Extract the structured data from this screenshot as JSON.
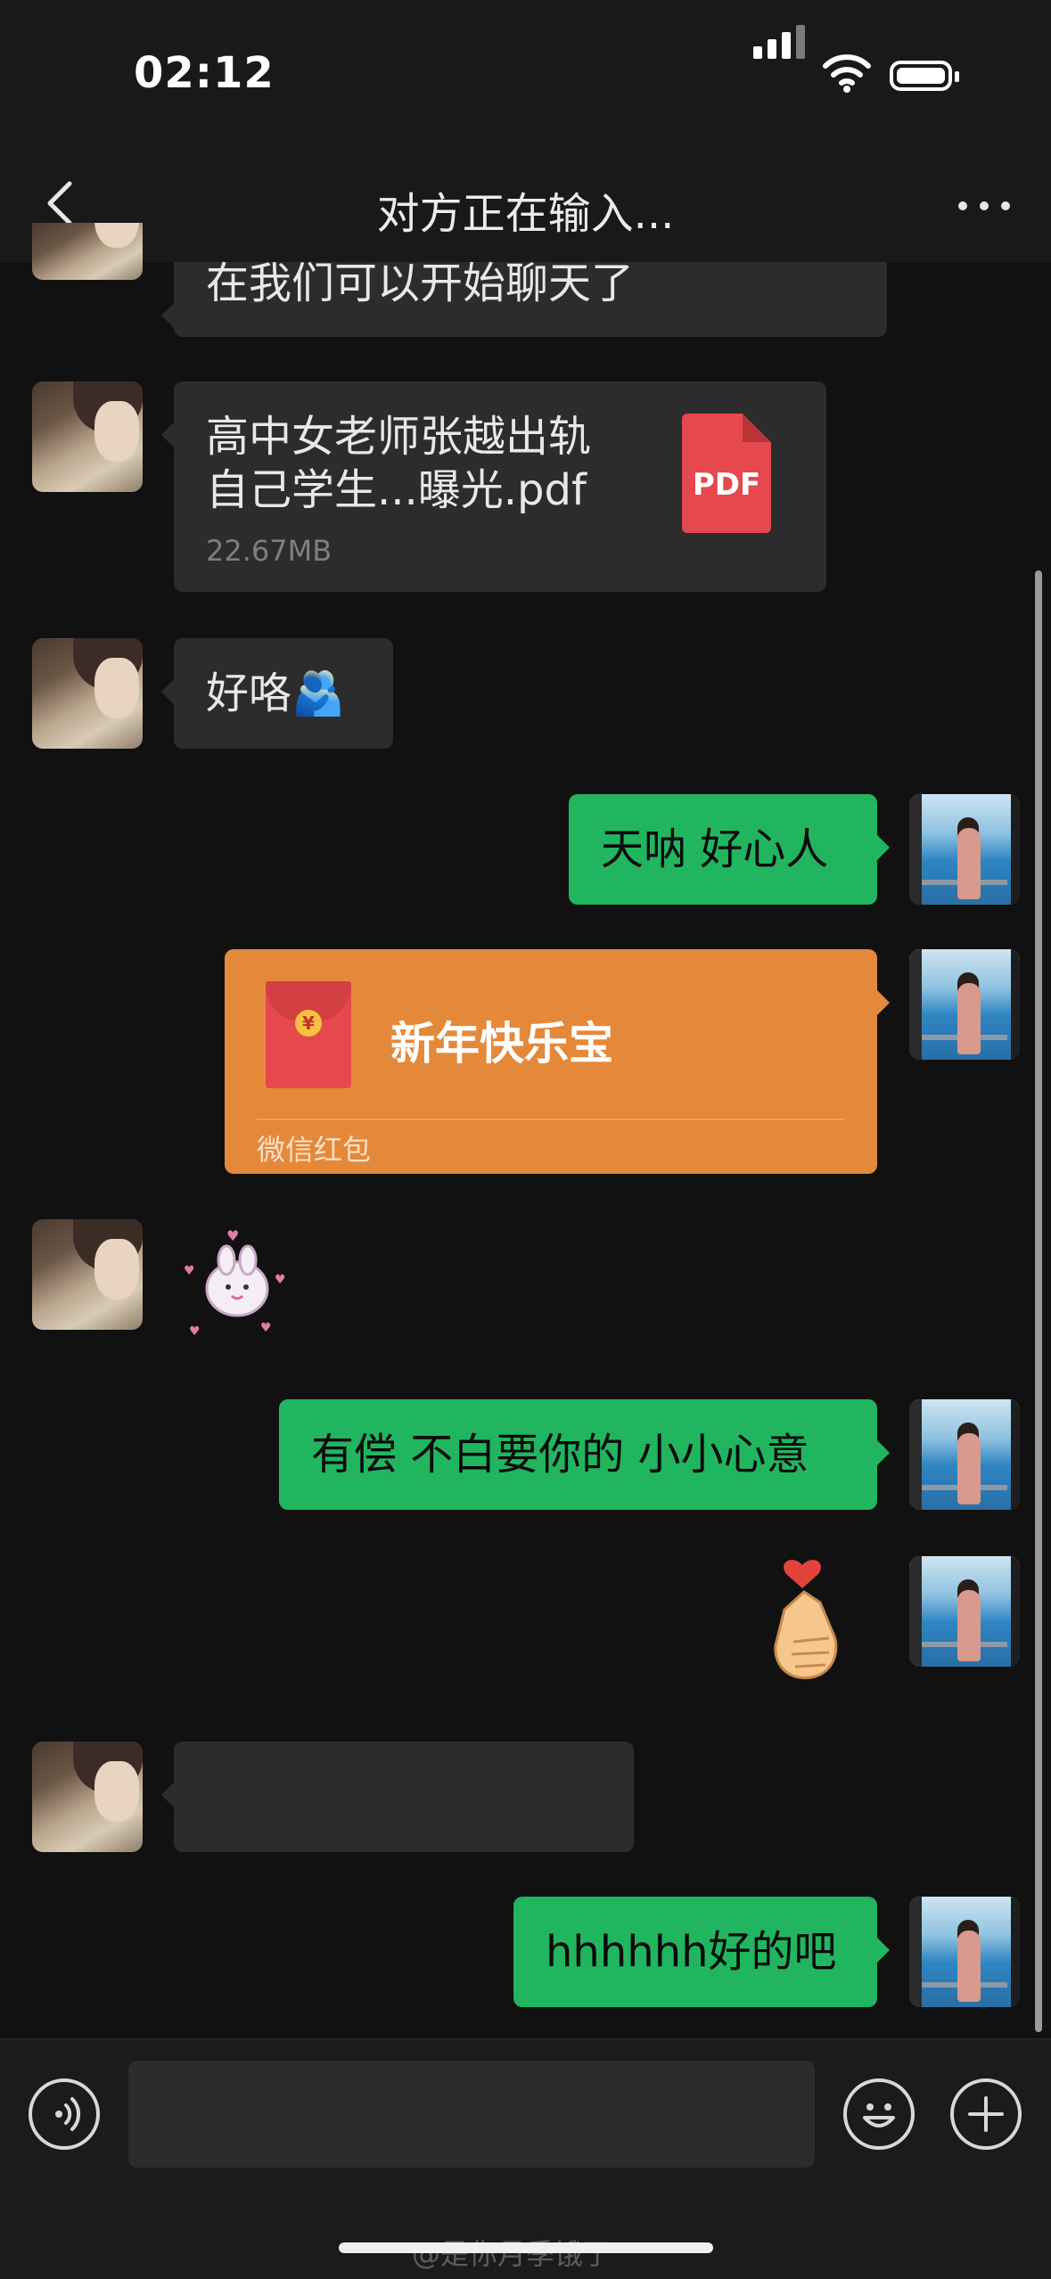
{
  "status_bar": {
    "time": "02:12"
  },
  "nav": {
    "title": "对方正在输入..."
  },
  "messages": {
    "m1_text": "在我们可以开始聊天了",
    "file": {
      "name": "高中女老师张越出轨自己学生...曝光.pdf",
      "size": "22.67MB",
      "badge": "PDF"
    },
    "m3_text": "好咯🫂",
    "m4_text": "天呐 好心人",
    "red_packet": {
      "title": "新年快乐宝",
      "label": "微信红包",
      "coin": "¥"
    },
    "m6_sticker": "bunny-sticker",
    "m7_text": "有偿 不白要你的 小小心意",
    "m8_sticker": "finger-heart-sticker",
    "m10_text": "hhhhhh好的吧"
  },
  "input": {
    "value": ""
  },
  "watermark": "@是你月季饿了"
}
